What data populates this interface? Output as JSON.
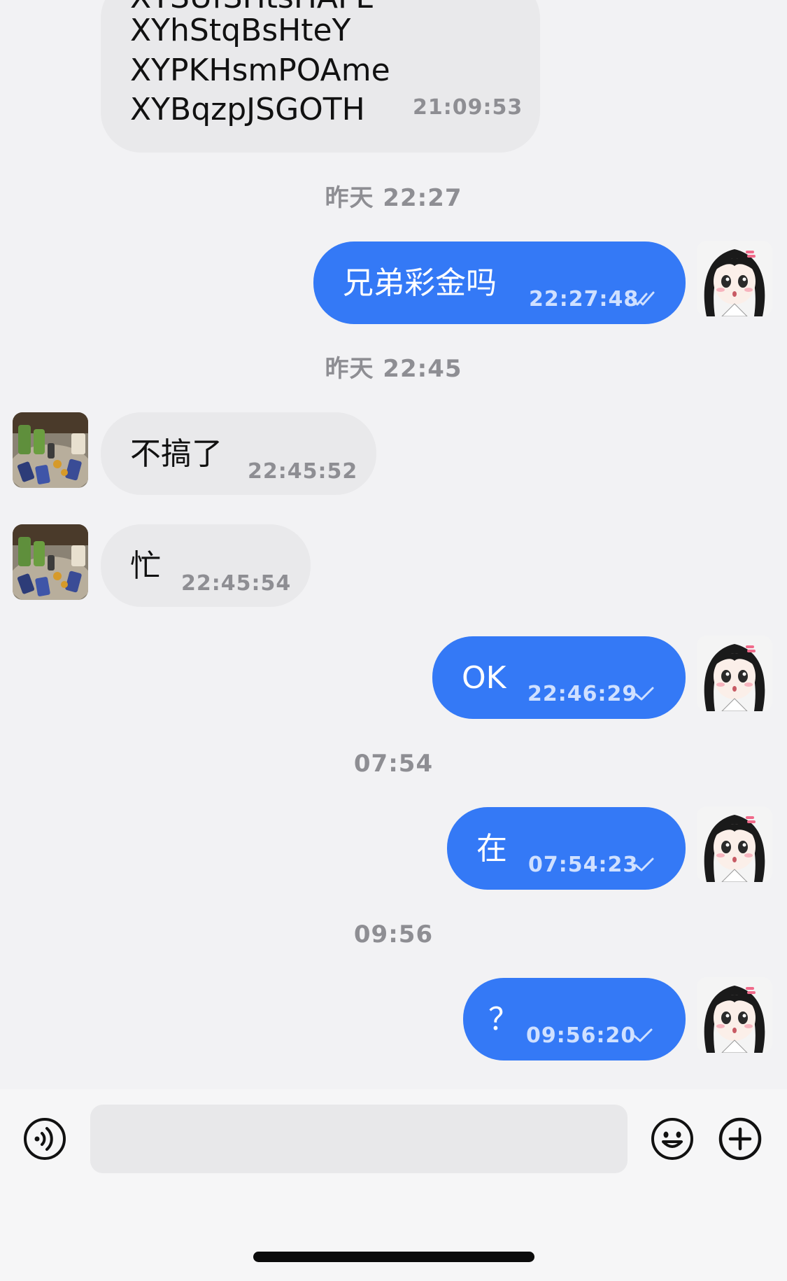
{
  "messages": [
    {
      "id": "m1",
      "direction": "in",
      "lines": [
        "XYSUfSHtsHAFL",
        "XYhStqBsHteY",
        "XYPKHsmPOAme",
        "XYBqzpJSGOTH"
      ],
      "time": "21:09:53"
    },
    {
      "id": "m2",
      "direction": "out",
      "text": "兄弟彩金吗",
      "time": "22:27:48",
      "status": "read"
    },
    {
      "id": "m3",
      "direction": "in",
      "text": "不搞了",
      "time": "22:45:52"
    },
    {
      "id": "m4",
      "direction": "in",
      "text": "忙",
      "time": "22:45:54"
    },
    {
      "id": "m5",
      "direction": "out",
      "text": "OK",
      "time": "22:46:29",
      "status": "sent"
    },
    {
      "id": "m6",
      "direction": "out",
      "text": "在",
      "time": "07:54:23",
      "status": "sent"
    },
    {
      "id": "m7",
      "direction": "out",
      "text": "？",
      "time": "09:56:20",
      "status": "sent"
    }
  ],
  "date_separators": [
    "昨天 22:27",
    "昨天 22:45",
    "07:54",
    "09:56"
  ],
  "input_bar": {
    "voice_icon": "voice-icon",
    "message_placeholder": "",
    "emoji_icon": "emoji-icon",
    "add_icon": "plus-circle-icon"
  },
  "colors": {
    "outgoing_bubble": "#3479f6",
    "incoming_bubble": "#e9e9eb",
    "background": "#f2f2f4",
    "timestamp_gray": "#8e8e93"
  }
}
